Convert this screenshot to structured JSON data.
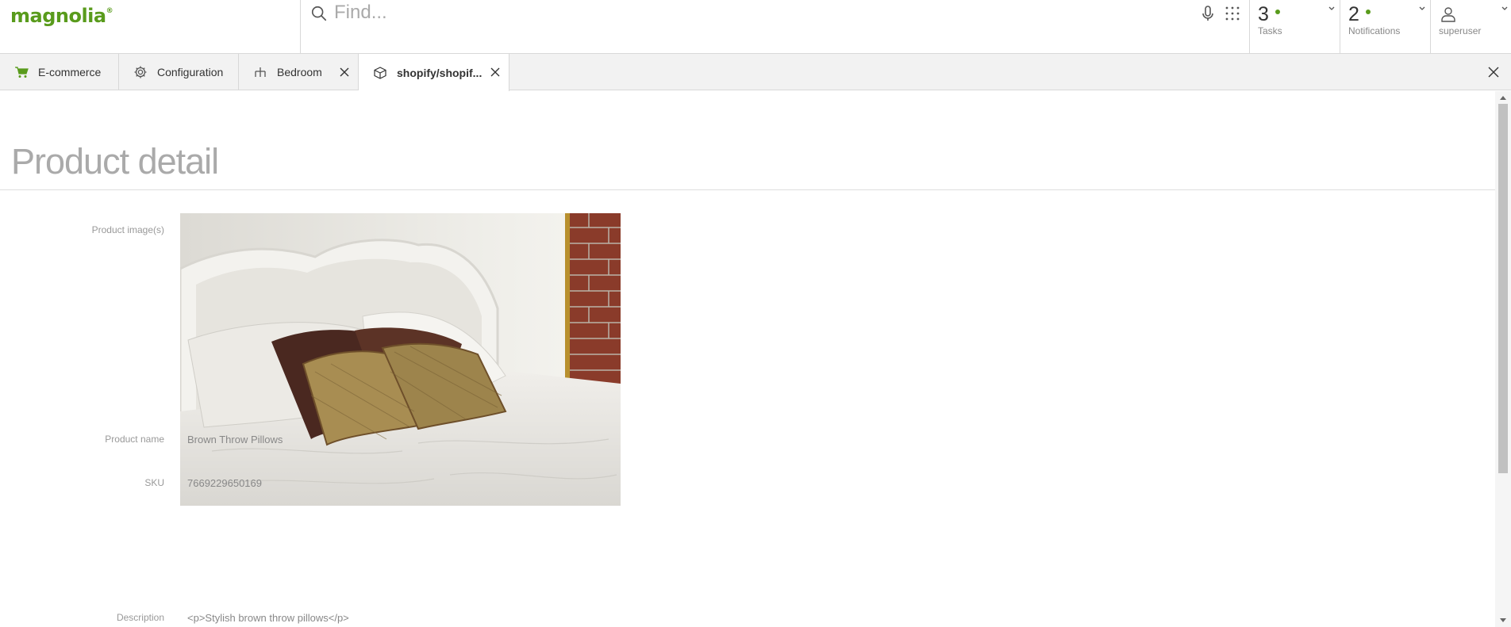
{
  "app": {
    "logo_text": "magnolia",
    "logo_mark": "®",
    "brand_color": "#599b1c"
  },
  "search": {
    "placeholder": "Find..."
  },
  "header": {
    "tasks": {
      "count": "3",
      "label": "Tasks"
    },
    "notifications": {
      "count": "2",
      "label": "Notifications"
    },
    "user": {
      "label": "superuser"
    }
  },
  "tabs": [
    {
      "label": "E-commerce",
      "icon": "cart-icon",
      "closable": false,
      "active": false
    },
    {
      "label": "Configuration",
      "icon": "gear-icon",
      "closable": false,
      "active": false
    },
    {
      "label": "Bedroom",
      "icon": "hierarchy-icon",
      "closable": true,
      "active": false
    },
    {
      "label": "shopify/shopif...",
      "icon": "cube-icon",
      "closable": true,
      "active": true
    }
  ],
  "page": {
    "title": "Product detail",
    "fields": {
      "images_label": "Product image(s)",
      "name_label": "Product name",
      "name_value": "Brown Throw Pillows",
      "sku_label": "SKU",
      "sku_value": "7669229650169",
      "description_label": "Description",
      "description_value": "<p>Stylish brown throw pillows</p>"
    }
  }
}
